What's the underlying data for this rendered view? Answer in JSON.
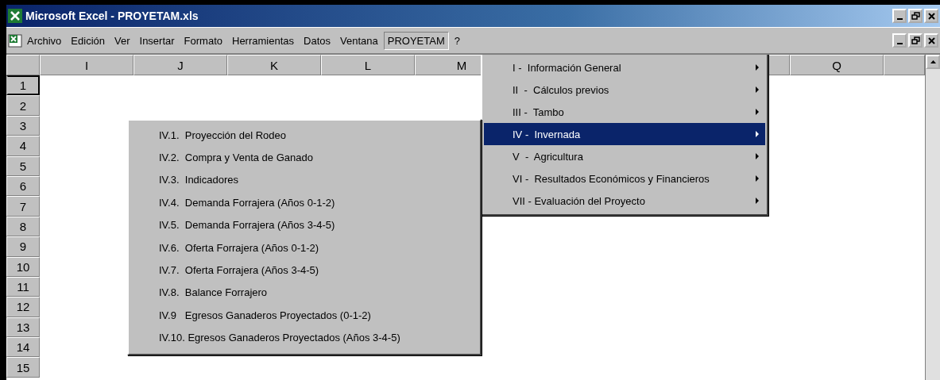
{
  "window": {
    "title": "Microsoft Excel - PROYETAM.xls"
  },
  "menubar": [
    {
      "label": "Archivo",
      "selected": false
    },
    {
      "label": "Edición",
      "selected": false
    },
    {
      "label": "Ver",
      "selected": false
    },
    {
      "label": "Insertar",
      "selected": false
    },
    {
      "label": "Formato",
      "selected": false
    },
    {
      "label": "Herramientas",
      "selected": false
    },
    {
      "label": "Datos",
      "selected": false
    },
    {
      "label": "Ventana",
      "selected": false
    },
    {
      "label": "PROYETAM",
      "selected": true
    },
    {
      "label": "?",
      "selected": false
    }
  ],
  "columns": [
    {
      "label": "I"
    },
    {
      "label": "J"
    },
    {
      "label": "K"
    },
    {
      "label": "L"
    },
    {
      "label": "M"
    },
    {
      "label": "Q"
    }
  ],
  "rows": [
    "1",
    "2",
    "3",
    "4",
    "5",
    "6",
    "7",
    "8",
    "9",
    "10",
    "11",
    "12",
    "13",
    "14",
    "15"
  ],
  "menu": {
    "items": [
      {
        "label": "I -  Información General",
        "selected": false,
        "submenu": true
      },
      {
        "label": "II  -  Cálculos previos",
        "selected": false,
        "submenu": true
      },
      {
        "label": "III -  Tambo",
        "selected": false,
        "submenu": true
      },
      {
        "label": "IV -  Invernada",
        "selected": true,
        "submenu": true
      },
      {
        "label": "V  -  Agricultura",
        "selected": false,
        "submenu": true
      },
      {
        "label": "VI -  Resultados Económicos y Financieros",
        "selected": false,
        "submenu": true
      },
      {
        "label": "VII - Evaluación del Proyecto",
        "selected": false,
        "submenu": true
      }
    ]
  },
  "submenu": {
    "items": [
      {
        "label": "IV.1.  Proyección del Rodeo"
      },
      {
        "label": "IV.2.  Compra y Venta de Ganado"
      },
      {
        "label": "IV.3.  Indicadores"
      },
      {
        "label": "IV.4.  Demanda Forrajera (Años 0-1-2)"
      },
      {
        "label": "IV.5.  Demanda Forrajera (Años 3-4-5)"
      },
      {
        "label": "IV.6.  Oferta Forrajera (Años 0-1-2)"
      },
      {
        "label": "IV.7.  Oferta Forrajera (Años 3-4-5)"
      },
      {
        "label": "IV.8.  Balance Forrajero"
      },
      {
        "label": "IV.9   Egresos Ganaderos Proyectados (0-1-2)"
      },
      {
        "label": "IV.10. Egresos Ganaderos Proyectados (Años 3-4-5)"
      }
    ]
  }
}
